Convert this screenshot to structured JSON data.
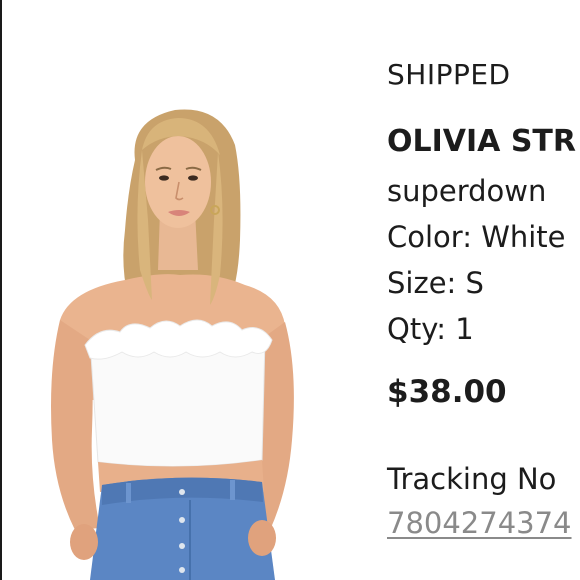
{
  "order_item": {
    "status": "SHIPPED",
    "product_name": "OLIVIA STR",
    "brand": "superdown",
    "color": "Color: White",
    "size": "Size: S",
    "qty": "Qty: 1",
    "price": "$38.00",
    "tracking_label": "Tracking No",
    "tracking_number": "7804274374"
  },
  "colors": {
    "text": "#1c1c1c",
    "link": "#8a8a8a",
    "background": "#ffffff"
  }
}
